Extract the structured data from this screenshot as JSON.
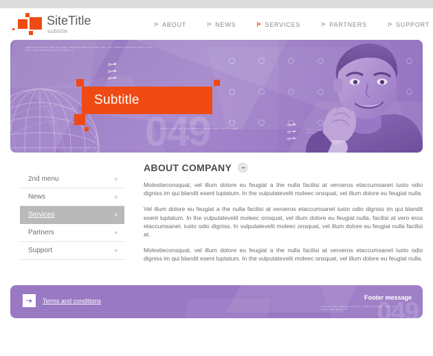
{
  "site": {
    "logo_title": "SiteTitle",
    "logo_subtitle": "subtitle"
  },
  "nav": {
    "items": [
      {
        "label": "ABOUT",
        "active": false
      },
      {
        "label": "NEWS",
        "active": false
      },
      {
        "label": "SERVICES",
        "active": true
      },
      {
        "label": "PARTNERS",
        "active": false
      },
      {
        "label": "SUPPORT",
        "active": false
      }
    ]
  },
  "banner": {
    "subtitle": "Subtitle",
    "watermark": "049",
    "micro_top_left": "AENIOSI SUPPUSIONTIS INCHE COL SUMERI PONFERNSI OMNIS LUE PLUMAS SERIL INSUL PHARMSUN MULTASETU ENAPIS E ERIC CURIS OCANS SEROSAMOUS SERI SOI SIMEAR E",
    "micro_bottom_right": "ASPIRONI SUOMIUSENTOS ANDRUS LOS DULOPIS NERMALE URMERI LUE PULSAN SERIL PRASUL PIN INNESTUNCOS UMEDAN SESURU ESAPIS ENPUS SOMMESIR",
    "micro_bottom_center": "SOMIONSI LOURI SERA SOMERI ESOLIENTU SOMMUS INVELIA MERI SOL SUMERI"
  },
  "sidebar": {
    "items": [
      {
        "label": "2nd menu",
        "chevron": "»",
        "active": false
      },
      {
        "label": "News",
        "chevron": "»",
        "active": false
      },
      {
        "label": "Services",
        "chevron": "»",
        "active": true
      },
      {
        "label": "Partners",
        "chevron": "»",
        "active": false
      },
      {
        "label": "Support",
        "chevron": "»",
        "active": false
      }
    ]
  },
  "article": {
    "title": "ABOUT COMPANY",
    "paragraphs": [
      "Molestieconsquat, vel illum dolore eu feugiat a the nulla facilisi at veroeros etaccumsanet iusto odio digniss im qui blandit esent luptatum. In the vulputatevelit moleec onsquat, vel illum dolore eu feugiat nulla.",
      "Vel illum dolore eu feugiat a the nulla facilisi at veroeros etaccumsanet iusto odio digniss im qui blandit esent luptatum. In the vulputatevelit moleec onsquat, vel illum dolore eu feugiat nulla, facilisi at vero eros etaccumsanet. iusto odio digniss. In vulputatevelit moleec onsquat, vel illum dolore eu feugiat nulla facilisi at.",
      "Molestieconsquat, vel illum dolore eu feugiat a the nulla facilisi at veroeros etaccumsanet iusto odio digniss im qui blandit esent luptatum. In the vulputatevelit moleec onsquat, vel illum dolore eu feugiat nulla."
    ]
  },
  "footer": {
    "terms_label": "Terms and conditions",
    "message": "Footer message",
    "watermark": "049",
    "micro": "SOMIRALIS SUPRI SUESINTOS ANCHE SOL SUMERI PRONFERNSI UMENS LUE PLUMAS SERIL PRASUL NIS"
  },
  "colors": {
    "accent_orange": "#ef4a14",
    "brand_purple": "#9a79c4",
    "top_strip_gray": "#dcdcdc",
    "sidebar_active_gray": "#b9b9b9",
    "text_gray": "#6b6b6b"
  }
}
